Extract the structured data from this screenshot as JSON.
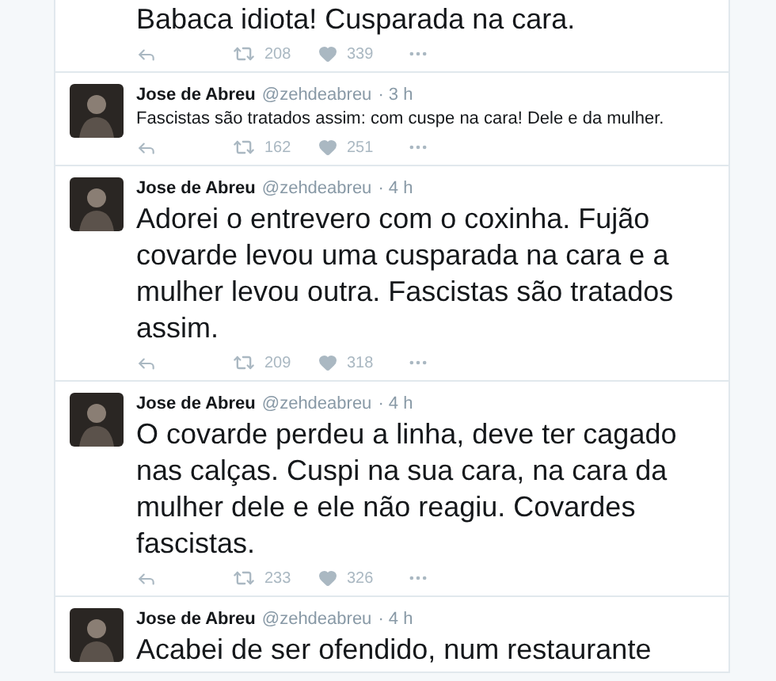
{
  "tweets": [
    {
      "kind": "large",
      "text": "Babaca idiota! Cusparada na cara.",
      "retweets": "208",
      "likes": "339"
    },
    {
      "kind": "small",
      "name": "Jose de Abreu",
      "handle": "@zehdeabreu",
      "time": "· 3 h",
      "text": "Fascistas são tratados assim: com cuspe na cara! Dele e da mulher.",
      "retweets": "162",
      "likes": "251"
    },
    {
      "kind": "large",
      "name": "Jose de Abreu",
      "handle": "@zehdeabreu",
      "time": "· 4 h",
      "text": "Adorei o entrevero com o coxinha. Fujão covarde levou uma cusparada na cara e a mulher levou outra. Fascistas são tratados assim.",
      "retweets": "209",
      "likes": "318"
    },
    {
      "kind": "large",
      "name": "Jose de Abreu",
      "handle": "@zehdeabreu",
      "time": "· 4 h",
      "text": "O covarde perdeu a linha, deve ter cagado nas calças. Cuspi na sua cara, na cara da mulher dele e ele não reagiu. Covardes fascistas.",
      "retweets": "233",
      "likes": "326"
    },
    {
      "kind": "large",
      "name": "Jose de Abreu",
      "handle": "@zehdeabreu",
      "time": "· 4 h",
      "text": "Acabei de ser ofendido, num restaurante"
    }
  ]
}
